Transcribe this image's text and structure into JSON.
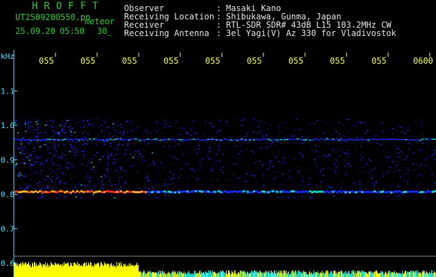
{
  "header": {
    "logo": "HROFFT",
    "filename": "UT2509200550.pn",
    "filename_suffix": "meteor",
    "date": "25.09.20",
    "time": "05:50",
    "duration": "30_",
    "fields": [
      {
        "label": "Observer",
        "sep": ":",
        "value": "Masaki Kano"
      },
      {
        "label": "Receiving Location",
        "sep": ":",
        "value": "Shibukawa, Gunma, Japan"
      },
      {
        "label": "Receiver",
        "sep": ":",
        "value": "RTL-SDR SDR# 43dB L15 103.2MHz CW"
      },
      {
        "label": "Receiving Antenna",
        "sep": ":",
        "value": "3el Yagi(V) Az 330 for Vladivostok"
      }
    ]
  },
  "chart_data": {
    "type": "heatmap",
    "title": "",
    "ylabel": "kHz",
    "y_ticks": [
      "1.1",
      "1.0",
      "0.9",
      "0.8",
      "0.7",
      "0.6"
    ],
    "x_ticks": [
      "055",
      "055",
      "055",
      "055",
      "055",
      "055",
      "055",
      "055",
      "055",
      "0600"
    ],
    "ylim": [
      0.6,
      1.15
    ],
    "signals": [
      {
        "name": "carrier",
        "freq_khz": 0.81
      },
      {
        "name": "band",
        "freq_khz": 0.96
      }
    ],
    "colors": {
      "background": "#000000",
      "low": "#1a2aff",
      "mid": "#19d6c8",
      "high": "#ff2b2b",
      "tick": "#ffff4a",
      "axis": "#5fe0ff",
      "level": "#ffff00"
    }
  }
}
